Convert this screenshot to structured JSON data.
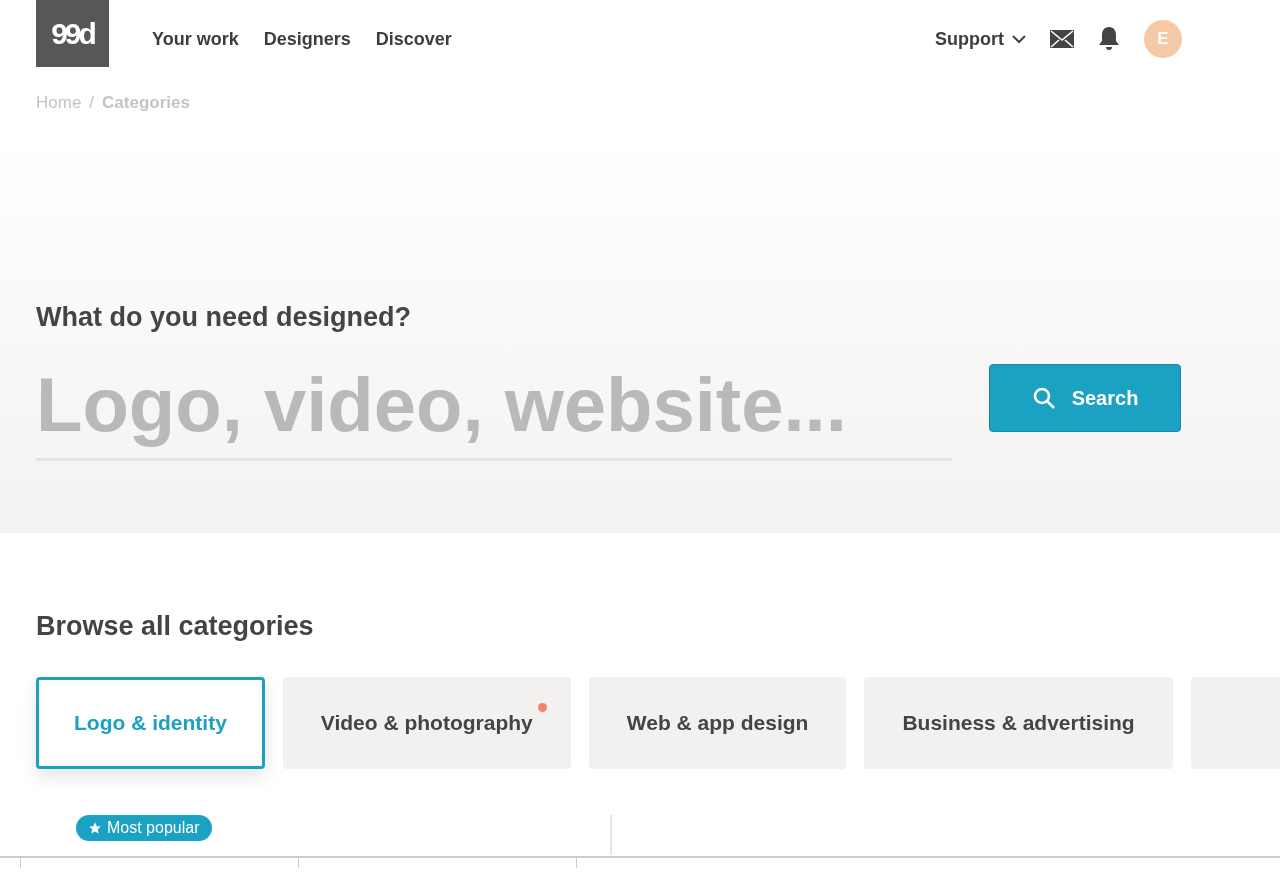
{
  "logo": {
    "text": "99d"
  },
  "nav": [
    {
      "label": "Your work"
    },
    {
      "label": "Designers"
    },
    {
      "label": "Discover"
    }
  ],
  "support": {
    "label": "Support"
  },
  "avatar": {
    "initial": "E"
  },
  "breadcrumb_separator": "/",
  "breadcrumb": [
    {
      "label": "Home",
      "current": false
    },
    {
      "label": "Categories",
      "current": true
    }
  ],
  "hero": {
    "title": "What do you need designed?",
    "placeholder": "Logo, video, website...",
    "button": "Search"
  },
  "browse": {
    "title": "Browse all categories",
    "categories": [
      {
        "label": "Logo & identity",
        "selected": true,
        "new": false
      },
      {
        "label": "Video & photography",
        "selected": false,
        "new": true
      },
      {
        "label": "Web & app design",
        "selected": false,
        "new": false
      },
      {
        "label": "Business & advertising",
        "selected": false,
        "new": false
      }
    ],
    "badge": "Most popular"
  }
}
